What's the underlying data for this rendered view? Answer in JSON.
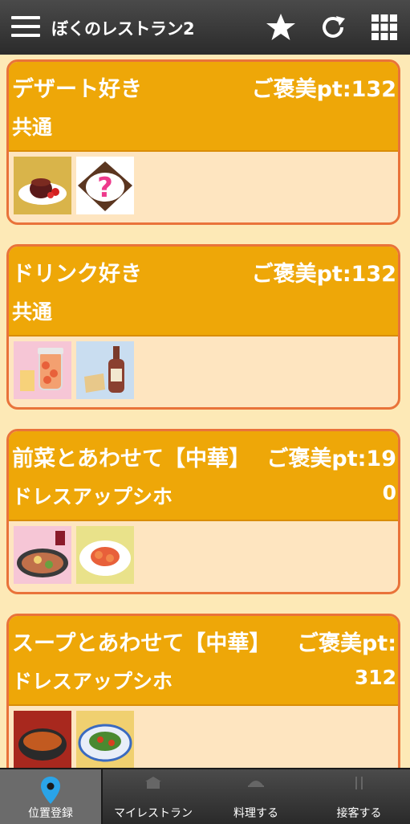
{
  "app": {
    "title": "ぼくのレストラン2"
  },
  "cards": [
    {
      "name": "デザート好き",
      "pt": "ご褒美pt:132",
      "sub": "共通",
      "sub2": ""
    },
    {
      "name": "ドリンク好き",
      "pt": "ご褒美pt:132",
      "sub": "共通",
      "sub2": ""
    },
    {
      "name": "前菜とあわせて【中華】",
      "pt": "ご褒美pt:19",
      "sub": "ドレスアップシホ",
      "sub2": "0"
    },
    {
      "name": "スープとあわせて【中華】",
      "pt": "ご褒美pt:",
      "sub": "ドレスアップシホ",
      "sub2": "312"
    }
  ],
  "tabs": [
    {
      "label": "位置登録",
      "icon": "map-pin-icon"
    },
    {
      "label": "マイレストラン",
      "icon": "restaurant-icon"
    },
    {
      "label": "料理する",
      "icon": "cooking-icon"
    },
    {
      "label": "接客する",
      "icon": "serving-icon"
    }
  ],
  "colors": {
    "header": "#eea708",
    "border": "#e9733a",
    "card_bg": "#fee5c0",
    "page_bg": "#fde9b6",
    "active_icon": "#2aa4e8"
  }
}
